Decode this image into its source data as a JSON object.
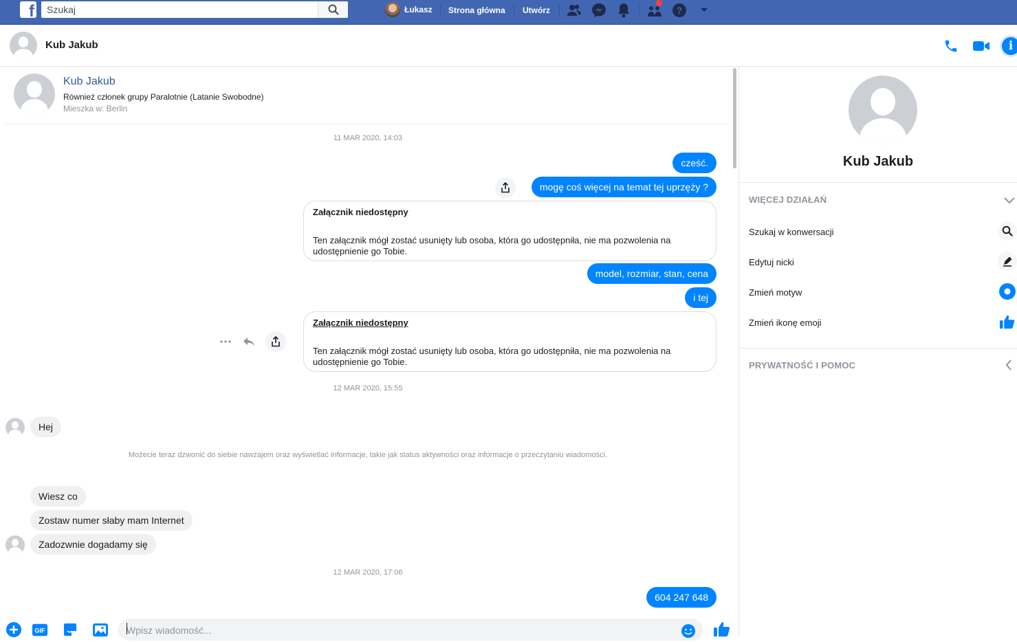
{
  "topbar": {
    "search_placeholder": "Szukaj",
    "user_name": "Łukasz",
    "home_label": "Strona główna",
    "create_label": "Utwórz",
    "brand_color": "#4267b2"
  },
  "conversation": {
    "contact_name": "Kub Jakub"
  },
  "intro": {
    "name": "Kub Jakub",
    "mutual": "Również członek grupy Paralotnie (Latanie Swobodne)",
    "location": "Mieszka w: Berlin"
  },
  "messages": {
    "stamp1": "11 MAR 2020, 14:03",
    "m1": "cześć.",
    "m2": "mogę coś więcej na temat tej uprzęży ?",
    "attach1_title": "Załącznik niedostępny",
    "attach1_body": "Ten załącznik mógł zostać usunięty lub osoba, która go udostępniła, nie ma pozwolenia na udostępnienie go Tobie.",
    "m3": "model, rozmiar, stan, cena",
    "m4": "i tej",
    "attach2_title": "Załącznik niedostępny",
    "attach2_body": "Ten załącznik mógł zostać usunięty lub osoba, która go udostępniła, nie ma pozwolenia na udostępnienie go Tobie.",
    "stamp2": "12 MAR 2020, 15:55",
    "in1": "Hej",
    "system": "Możecie teraz dzwonić do siebie nawzajem oraz wyświetlać informacje, takie jak status aktywności oraz informacje o przeczytaniu wiadomości.",
    "in2": "Wiesz co",
    "in3": "Zostaw numer słaby mam Internet",
    "in4": "Zadozwnie dogadamy się",
    "stamp3": "12 MAR 2020, 17:06",
    "m5": "604 247 648"
  },
  "composer": {
    "placeholder": "Wpisz wiadomość...",
    "gif_label": "GIF"
  },
  "right_panel": {
    "name": "Kub Jakub",
    "more_actions": "WIĘCEJ DZIAŁAŃ",
    "items": [
      {
        "label": "Szukaj w konwersacji",
        "icon": "search-icon"
      },
      {
        "label": "Edytuj nicki",
        "icon": "pencil-icon"
      },
      {
        "label": "Zmień motyw",
        "icon": "theme-icon"
      },
      {
        "label": "Zmień ikonę emoji",
        "icon": "thumbs-up-icon"
      }
    ],
    "privacy": "PRYWATNOŚĆ I POMOC"
  },
  "colors": {
    "accent": "#0084ff",
    "incoming_bubble": "#f1f0f0"
  }
}
